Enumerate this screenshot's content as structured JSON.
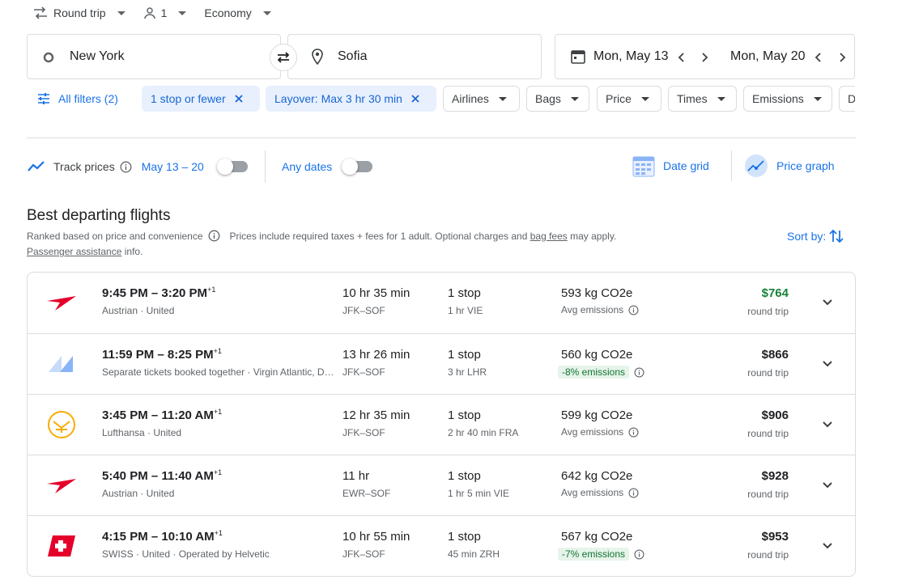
{
  "colors": {
    "accent": "#1a73e8",
    "selected_chip_bg": "#e8f0fe",
    "price_green": "#188038",
    "emissions_badge_bg": "#e6f4ea"
  },
  "topbar": {
    "trip_type": "Round trip",
    "passengers": "1",
    "cabin": "Economy"
  },
  "search": {
    "origin": "New York",
    "destination": "Sofia",
    "depart_date": "Mon, May 13",
    "return_date": "Mon, May 20"
  },
  "filters": {
    "all_filters": "All filters (2)",
    "chips": [
      {
        "label": "1 stop or fewer"
      },
      {
        "label": "Layover: Max 3 hr 30 min"
      },
      {
        "label": "Airlines"
      },
      {
        "label": "Bags"
      },
      {
        "label": "Price"
      },
      {
        "label": "Times"
      },
      {
        "label": "Emissions"
      },
      {
        "label": "D"
      }
    ]
  },
  "tools": {
    "track_prices": "Track prices",
    "track_range": "May 13 – 20",
    "any_dates": "Any dates",
    "date_grid": "Date grid",
    "price_graph": "Price graph"
  },
  "results": {
    "title": "Best departing flights",
    "ranked": "Ranked based on price and convenience",
    "prices_note_1": "Prices include required taxes + fees for 1 adult. Optional charges and",
    "bag_fees": "bag fees",
    "prices_note_2": "may apply.",
    "passenger_assistance": "Passenger assistance",
    "info": "info.",
    "sort_by": "Sort by:"
  },
  "flights": [
    {
      "times": "9:45 PM – 3:20 PM",
      "plus": "+1",
      "airline": "Austrian · United",
      "duration": "10 hr 35 min",
      "route": "JFK–SOF",
      "stops": "1 stop",
      "layover": "1 hr VIE",
      "co2": "593 kg CO2e",
      "emissions": "Avg emissions",
      "price": "$764",
      "price_type": "round trip",
      "logo": "austrian-logo"
    },
    {
      "times": "11:59 PM – 8:25 PM",
      "plus": "+1",
      "airline": "Separate tickets booked together · Virgin Atlantic, Delta",
      "duration": "13 hr 26 min",
      "route": "JFK–SOF",
      "stops": "1 stop",
      "layover": "3 hr LHR",
      "co2": "560 kg CO2e",
      "emissions": "-8% emissions",
      "price": "$866",
      "price_type": "round trip",
      "logo": "multi-airline-logo"
    },
    {
      "times": "3:45 PM – 11:20 AM",
      "plus": "+1",
      "airline": "Lufthansa · United",
      "duration": "12 hr 35 min",
      "route": "JFK–SOF",
      "stops": "1 stop",
      "layover": "2 hr 40 min FRA",
      "co2": "599 kg CO2e",
      "emissions": "Avg emissions",
      "price": "$906",
      "price_type": "round trip",
      "logo": "lufthansa-logo"
    },
    {
      "times": "5:40 PM – 11:40 AM",
      "plus": "+1",
      "airline": "Austrian · United",
      "duration": "11 hr",
      "route": "EWR–SOF",
      "stops": "1 stop",
      "layover": "1 hr 5 min VIE",
      "co2": "642 kg CO2e",
      "emissions": "Avg emissions",
      "price": "$928",
      "price_type": "round trip",
      "logo": "austrian-logo"
    },
    {
      "times": "4:15 PM – 10:10 AM",
      "plus": "+1",
      "airline": "SWISS · United · Operated by Helvetic",
      "duration": "10 hr 55 min",
      "route": "JFK–SOF",
      "stops": "1 stop",
      "layover": "45 min ZRH",
      "co2": "567 kg CO2e",
      "emissions": "-7% emissions",
      "price": "$953",
      "price_type": "round trip",
      "logo": "swiss-logo"
    }
  ]
}
